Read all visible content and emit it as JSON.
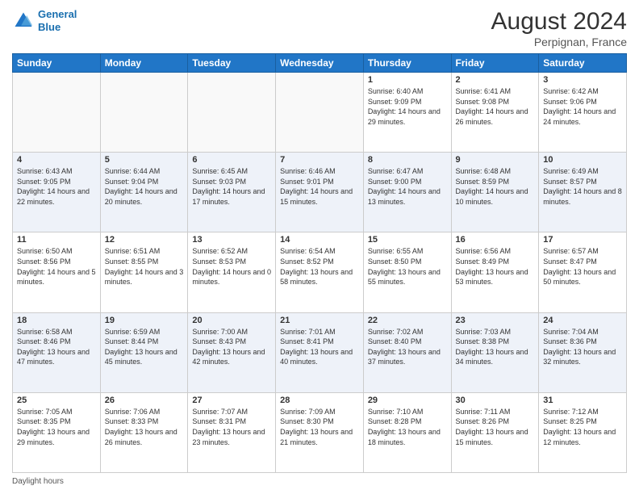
{
  "header": {
    "logo_line1": "General",
    "logo_line2": "Blue",
    "month_year": "August 2024",
    "location": "Perpignan, France"
  },
  "footer": {
    "label": "Daylight hours"
  },
  "days_of_week": [
    "Sunday",
    "Monday",
    "Tuesday",
    "Wednesday",
    "Thursday",
    "Friday",
    "Saturday"
  ],
  "weeks": [
    [
      {
        "day": "",
        "info": ""
      },
      {
        "day": "",
        "info": ""
      },
      {
        "day": "",
        "info": ""
      },
      {
        "day": "",
        "info": ""
      },
      {
        "day": "1",
        "info": "Sunrise: 6:40 AM\nSunset: 9:09 PM\nDaylight: 14 hours and 29 minutes."
      },
      {
        "day": "2",
        "info": "Sunrise: 6:41 AM\nSunset: 9:08 PM\nDaylight: 14 hours and 26 minutes."
      },
      {
        "day": "3",
        "info": "Sunrise: 6:42 AM\nSunset: 9:06 PM\nDaylight: 14 hours and 24 minutes."
      }
    ],
    [
      {
        "day": "4",
        "info": "Sunrise: 6:43 AM\nSunset: 9:05 PM\nDaylight: 14 hours and 22 minutes."
      },
      {
        "day": "5",
        "info": "Sunrise: 6:44 AM\nSunset: 9:04 PM\nDaylight: 14 hours and 20 minutes."
      },
      {
        "day": "6",
        "info": "Sunrise: 6:45 AM\nSunset: 9:03 PM\nDaylight: 14 hours and 17 minutes."
      },
      {
        "day": "7",
        "info": "Sunrise: 6:46 AM\nSunset: 9:01 PM\nDaylight: 14 hours and 15 minutes."
      },
      {
        "day": "8",
        "info": "Sunrise: 6:47 AM\nSunset: 9:00 PM\nDaylight: 14 hours and 13 minutes."
      },
      {
        "day": "9",
        "info": "Sunrise: 6:48 AM\nSunset: 8:59 PM\nDaylight: 14 hours and 10 minutes."
      },
      {
        "day": "10",
        "info": "Sunrise: 6:49 AM\nSunset: 8:57 PM\nDaylight: 14 hours and 8 minutes."
      }
    ],
    [
      {
        "day": "11",
        "info": "Sunrise: 6:50 AM\nSunset: 8:56 PM\nDaylight: 14 hours and 5 minutes."
      },
      {
        "day": "12",
        "info": "Sunrise: 6:51 AM\nSunset: 8:55 PM\nDaylight: 14 hours and 3 minutes."
      },
      {
        "day": "13",
        "info": "Sunrise: 6:52 AM\nSunset: 8:53 PM\nDaylight: 14 hours and 0 minutes."
      },
      {
        "day": "14",
        "info": "Sunrise: 6:54 AM\nSunset: 8:52 PM\nDaylight: 13 hours and 58 minutes."
      },
      {
        "day": "15",
        "info": "Sunrise: 6:55 AM\nSunset: 8:50 PM\nDaylight: 13 hours and 55 minutes."
      },
      {
        "day": "16",
        "info": "Sunrise: 6:56 AM\nSunset: 8:49 PM\nDaylight: 13 hours and 53 minutes."
      },
      {
        "day": "17",
        "info": "Sunrise: 6:57 AM\nSunset: 8:47 PM\nDaylight: 13 hours and 50 minutes."
      }
    ],
    [
      {
        "day": "18",
        "info": "Sunrise: 6:58 AM\nSunset: 8:46 PM\nDaylight: 13 hours and 47 minutes."
      },
      {
        "day": "19",
        "info": "Sunrise: 6:59 AM\nSunset: 8:44 PM\nDaylight: 13 hours and 45 minutes."
      },
      {
        "day": "20",
        "info": "Sunrise: 7:00 AM\nSunset: 8:43 PM\nDaylight: 13 hours and 42 minutes."
      },
      {
        "day": "21",
        "info": "Sunrise: 7:01 AM\nSunset: 8:41 PM\nDaylight: 13 hours and 40 minutes."
      },
      {
        "day": "22",
        "info": "Sunrise: 7:02 AM\nSunset: 8:40 PM\nDaylight: 13 hours and 37 minutes."
      },
      {
        "day": "23",
        "info": "Sunrise: 7:03 AM\nSunset: 8:38 PM\nDaylight: 13 hours and 34 minutes."
      },
      {
        "day": "24",
        "info": "Sunrise: 7:04 AM\nSunset: 8:36 PM\nDaylight: 13 hours and 32 minutes."
      }
    ],
    [
      {
        "day": "25",
        "info": "Sunrise: 7:05 AM\nSunset: 8:35 PM\nDaylight: 13 hours and 29 minutes."
      },
      {
        "day": "26",
        "info": "Sunrise: 7:06 AM\nSunset: 8:33 PM\nDaylight: 13 hours and 26 minutes."
      },
      {
        "day": "27",
        "info": "Sunrise: 7:07 AM\nSunset: 8:31 PM\nDaylight: 13 hours and 23 minutes."
      },
      {
        "day": "28",
        "info": "Sunrise: 7:09 AM\nSunset: 8:30 PM\nDaylight: 13 hours and 21 minutes."
      },
      {
        "day": "29",
        "info": "Sunrise: 7:10 AM\nSunset: 8:28 PM\nDaylight: 13 hours and 18 minutes."
      },
      {
        "day": "30",
        "info": "Sunrise: 7:11 AM\nSunset: 8:26 PM\nDaylight: 13 hours and 15 minutes."
      },
      {
        "day": "31",
        "info": "Sunrise: 7:12 AM\nSunset: 8:25 PM\nDaylight: 13 hours and 12 minutes."
      }
    ]
  ]
}
